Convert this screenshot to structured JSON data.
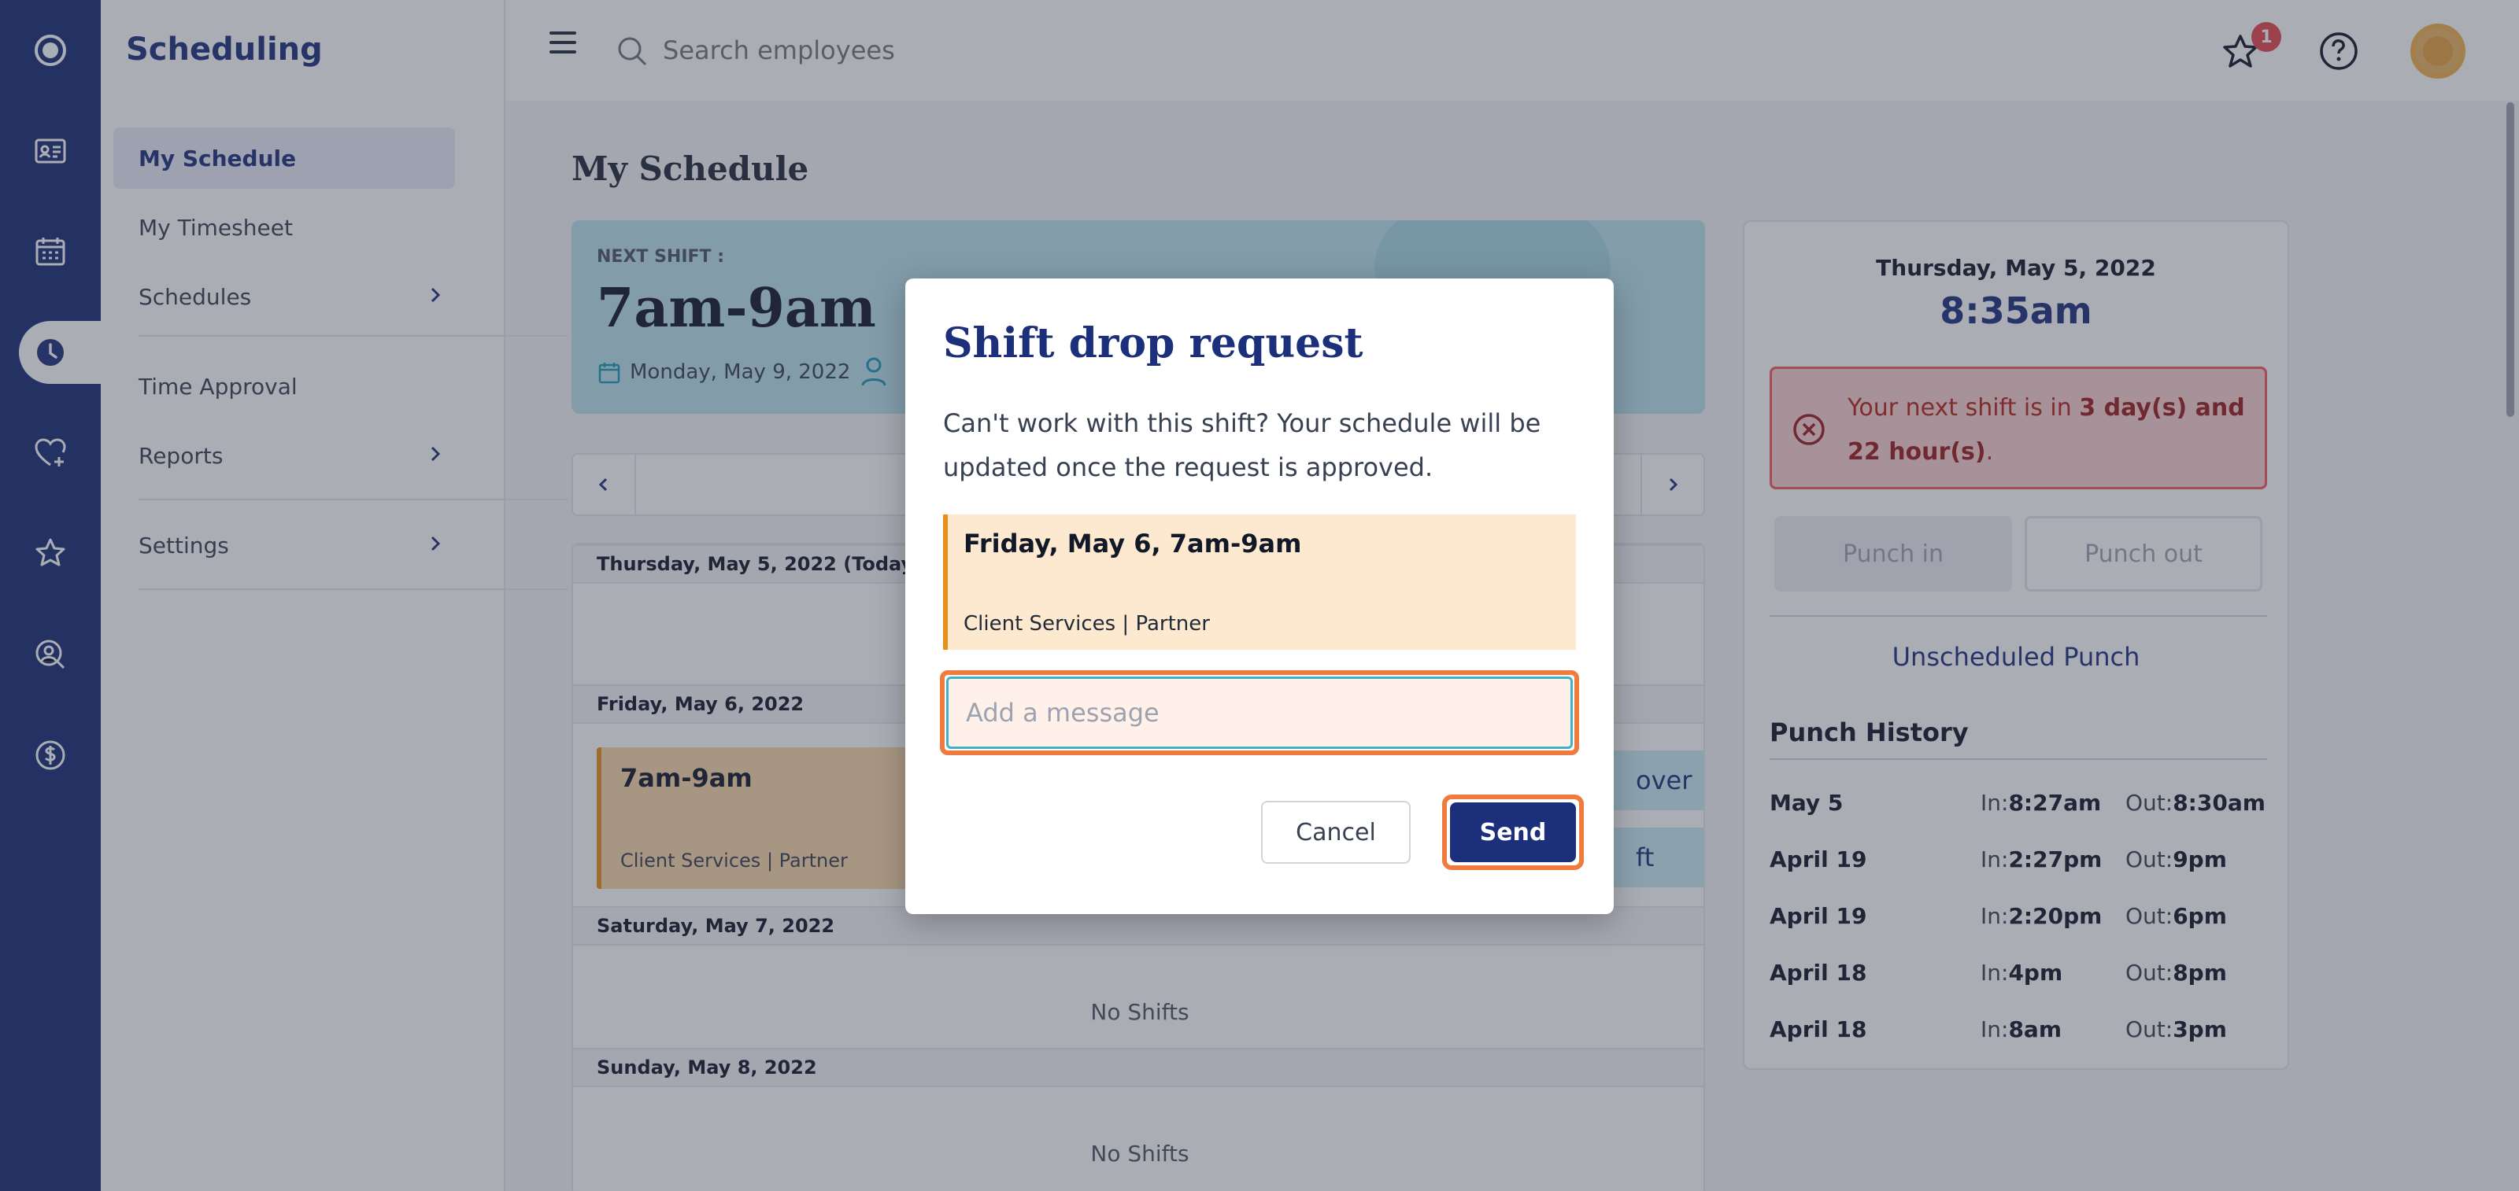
{
  "app": {
    "section_title": "Scheduling"
  },
  "nav": {
    "items": [
      {
        "label": "My Schedule"
      },
      {
        "label": "My Timesheet"
      },
      {
        "label": "Schedules"
      },
      {
        "label": "Time Approval"
      },
      {
        "label": "Reports"
      },
      {
        "label": "Settings"
      }
    ]
  },
  "topbar": {
    "search_placeholder": "Search employees",
    "notification_count": "1"
  },
  "page": {
    "title": "My Schedule"
  },
  "next_shift": {
    "label": "NEXT SHIFT :",
    "time": "7am-9am",
    "date": "Monday, May 9, 2022"
  },
  "schedule": {
    "days": [
      {
        "header": "Thursday, May 5, 2022 (Today)"
      },
      {
        "header": "Friday, May 6, 2022",
        "shift_time": "7am-9am",
        "shift_sub": "Client Services | Partner",
        "btn1": "over",
        "btn2": "ft"
      },
      {
        "header": "Saturday, May 7, 2022",
        "empty": "No Shifts"
      },
      {
        "header": "Sunday, May 8, 2022",
        "empty": "No Shifts"
      }
    ]
  },
  "panel": {
    "date": "Thursday, May 5, 2022",
    "time": "8:35am",
    "alert_prefix": "Your next shift is in ",
    "alert_strong": "3 day(s) and 22 hour(s)",
    "alert_suffix": ".",
    "punch_in": "Punch in",
    "punch_out": "Punch out",
    "unscheduled": "Unscheduled Punch",
    "history_title": "Punch History",
    "in_label": "In:",
    "out_label": "Out:",
    "history": [
      {
        "date": "May 5",
        "in": "8:27am",
        "out": "8:30am"
      },
      {
        "date": "April 19",
        "in": "2:27pm",
        "out": "9pm"
      },
      {
        "date": "April 19",
        "in": "2:20pm",
        "out": "6pm"
      },
      {
        "date": "April 18",
        "in": "4pm",
        "out": "8pm"
      },
      {
        "date": "April 18",
        "in": "8am",
        "out": "3pm"
      }
    ]
  },
  "modal": {
    "title": "Shift drop request",
    "text": "Can't work with this shift? Your schedule will be updated once the request is approved.",
    "shift_title": "Friday, May 6, 7am-9am",
    "shift_sub": "Client Services |  Partner",
    "message_placeholder": "Add a message",
    "cancel": "Cancel",
    "send": "Send"
  },
  "colors": {
    "brand": "#1b2f7a",
    "highlight": "#f07b3f",
    "alert": "#ef5a5a",
    "shift": "#e8901c"
  }
}
